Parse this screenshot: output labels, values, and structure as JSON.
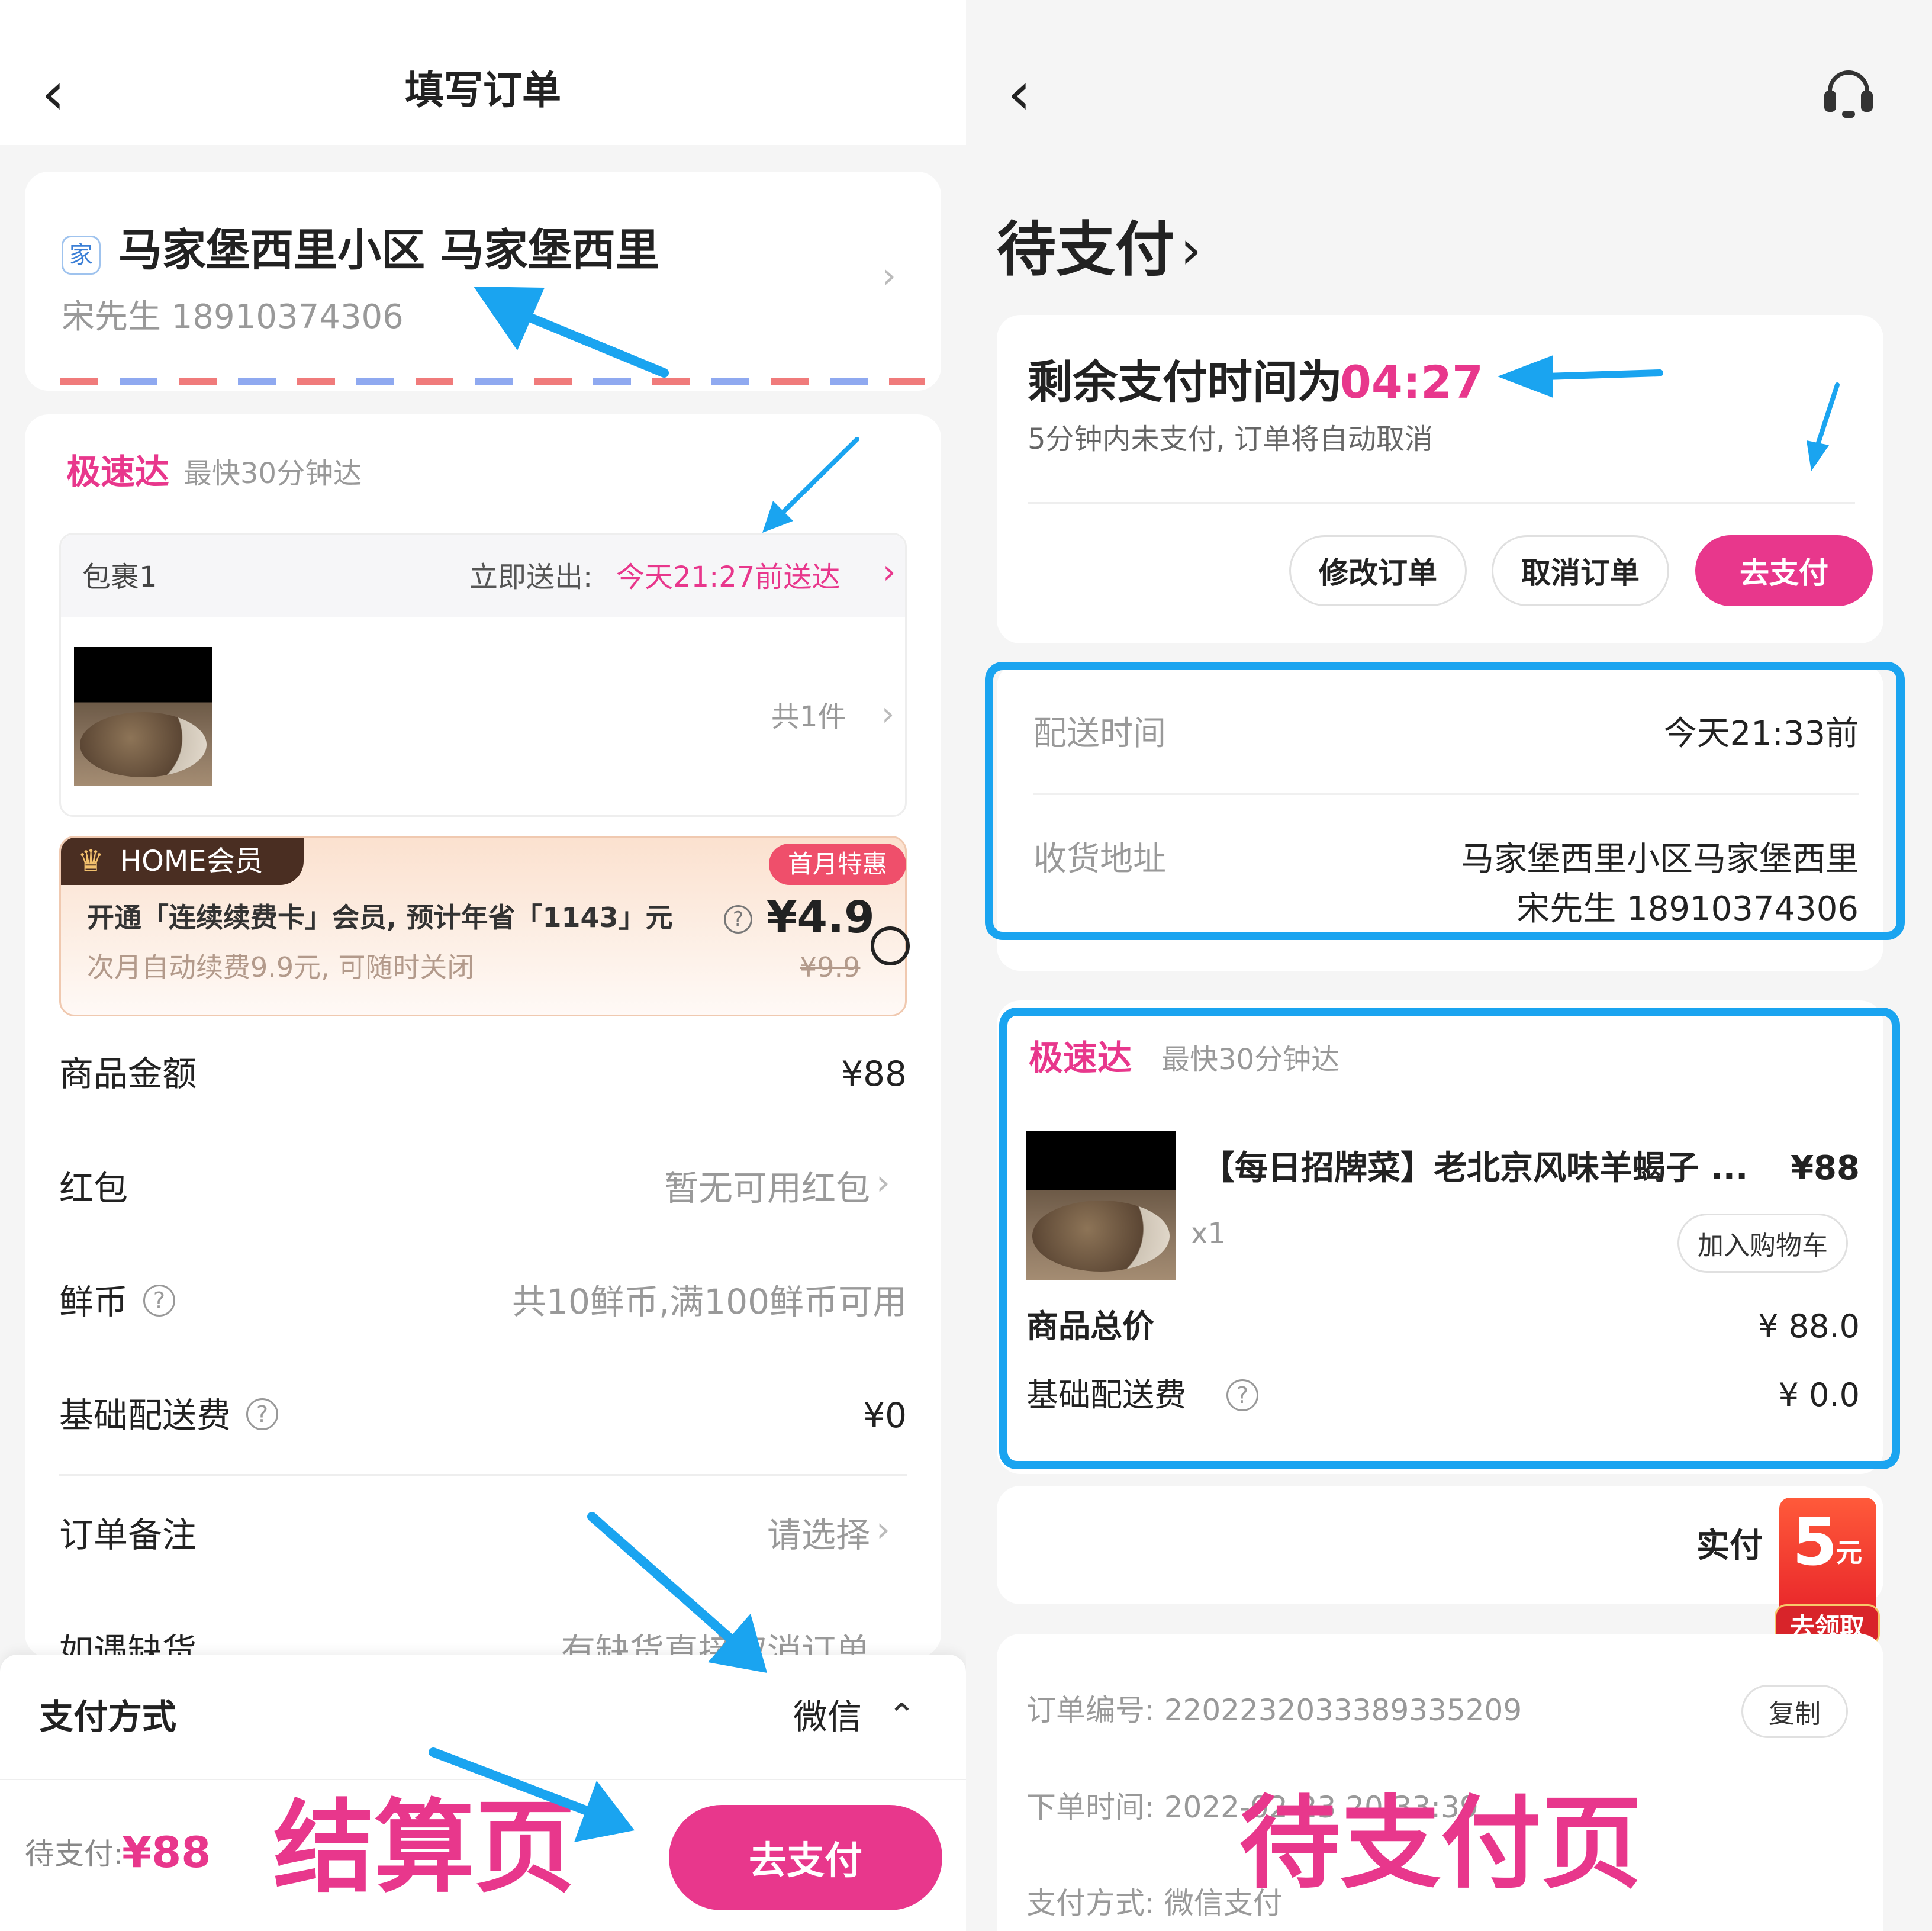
{
  "checkout": {
    "title": "填写订单",
    "address": {
      "tag": "家",
      "line": "马家堡西里小区 马家堡西里",
      "contact": "宋先生 18910374306"
    },
    "delivery": {
      "name": "极速达",
      "note": "最快30分钟达",
      "package_label": "包裹1",
      "send_prefix": "立即送出:",
      "send_time": "今天21:27前送达",
      "item_count": "共1件"
    },
    "member": {
      "badge": "HOME会员",
      "promo": "首月特惠",
      "desc": "开通「连续续费卡」会员, 预计年省「1143」元",
      "price": "¥4.9",
      "subdesc": "次月自动续费9.9元, 可随时关闭",
      "old_price": "¥9.9"
    },
    "rows": [
      {
        "label": "商品金额",
        "value": "¥88"
      },
      {
        "label": "红包",
        "value": "暂无可用红包"
      },
      {
        "label": "鲜币",
        "value": "共10鲜币,满100鲜币可用"
      },
      {
        "label": "基础配送费",
        "value": "¥0"
      },
      {
        "label": "订单备注",
        "value": "请选择"
      },
      {
        "label": "如遇缺货",
        "value": "有缺货直接取消订单"
      }
    ],
    "payment": {
      "label": "支付方式",
      "value": "微信"
    },
    "footer": {
      "pending_label": "待支付:",
      "pending_amount": "¥88",
      "pay_button": "去支付"
    },
    "annotation": "结算页"
  },
  "pending": {
    "title": "待支付",
    "countdown_prefix": "剩余支付时间为",
    "countdown": "04:27",
    "notice": "5分钟内未支付, 订单将自动取消",
    "buttons": {
      "modify": "修改订单",
      "cancel": "取消订单",
      "pay": "去支付"
    },
    "delivery_time_label": "配送时间",
    "delivery_time_value": "今天21:33前",
    "address_label": "收货地址",
    "address_line": "马家堡西里小区马家堡西里",
    "address_contact": "宋先生 18910374306",
    "express": {
      "name": "极速达",
      "note": "最快30分钟达"
    },
    "product": {
      "name": "【每日招牌菜】老北京风味羊蝎子 ...",
      "price": "¥88",
      "qty": "x1",
      "add_cart": "加入购物车"
    },
    "total_label": "商品总价",
    "total_value": "¥ 88.0",
    "ship_label": "基础配送费",
    "ship_value": "¥ 0.0",
    "actual_label": "实付",
    "coupon": {
      "amount": "5",
      "unit": "元",
      "action": "去领取"
    },
    "order_no": "订单编号: 2202232033389335209",
    "copy": "复制",
    "order_time": "下单时间: 2022-02-23 20:33:39",
    "pay_method": "支付方式: 微信支付",
    "annotation": "待支付页"
  },
  "colors": {
    "accent": "#e8378c",
    "highlight": "#1aa4f0",
    "gray": "#999999"
  }
}
